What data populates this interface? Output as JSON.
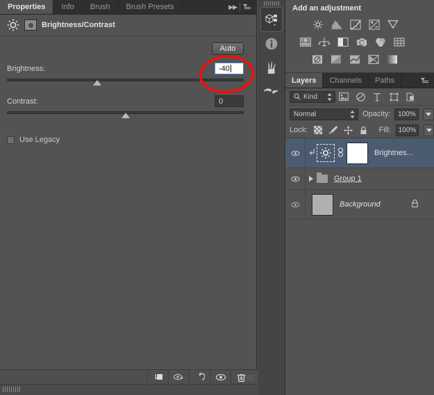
{
  "properties_panel": {
    "tabs": [
      {
        "label": "Properties",
        "active": true
      },
      {
        "label": "Info",
        "active": false
      },
      {
        "label": "Brush",
        "active": false
      },
      {
        "label": "Brush Presets",
        "active": false
      }
    ],
    "collapse_icon": "double-chevron-right-icon",
    "menu_icon": "panel-menu-icon",
    "header": {
      "adjustment_icon": "brightness-contrast-icon",
      "mask_icon": "layer-mask-thumbnail",
      "title": "Brightness/Contrast"
    },
    "auto_button": "Auto",
    "brightness": {
      "label": "Brightness:",
      "value": "-40",
      "slider_percent": 38,
      "focused": true
    },
    "contrast": {
      "label": "Contrast:",
      "value": "0",
      "slider_percent": 50,
      "focused": false
    },
    "use_legacy": {
      "label": "Use Legacy",
      "checked": false
    },
    "footer_icons": [
      "clip-to-layer-icon",
      "view-previous-state-icon",
      "reset-adjustment-icon",
      "toggle-visibility-icon",
      "delete-adjustment-icon"
    ]
  },
  "dock": {
    "items": [
      {
        "name": "mini-bridge-icon",
        "active": true
      },
      {
        "name": "info-icon",
        "active": false
      },
      {
        "name": "brush-icon",
        "active": false
      },
      {
        "name": "brush-presets-icon",
        "active": false
      }
    ]
  },
  "adjustments_panel": {
    "title": "Add an adjustment",
    "row1": [
      "brightness-contrast-icon",
      "levels-icon",
      "curves-icon",
      "exposure-icon",
      "vibrance-icon"
    ],
    "row2": [
      "color-balance-icon",
      "black-and-white-icon",
      "photo-filter-icon",
      "channel-mixer-icon",
      "color-lookup-icon",
      "posterize-icon"
    ],
    "row3": [
      "invert-icon",
      "threshold-icon",
      "selective-color-icon",
      "gradient-map-icon",
      "gradient-fill-icon"
    ]
  },
  "layers_panel": {
    "tabs": [
      {
        "label": "Layers",
        "active": true
      },
      {
        "label": "Channels",
        "active": false
      },
      {
        "label": "Paths",
        "active": false
      }
    ],
    "menu_icon": "panel-menu-icon",
    "filter": {
      "search_icon": "search-icon",
      "kind_label": "Kind",
      "type_icons": [
        "pixel-layer-filter-icon",
        "adjustment-layer-filter-icon",
        "type-layer-filter-icon",
        "shape-layer-filter-icon",
        "smart-object-filter-icon"
      ]
    },
    "blend_mode": "Normal",
    "opacity_label": "Opacity:",
    "opacity_value": "100%",
    "lock_label": "Lock:",
    "lock_icons": [
      "lock-transparency-icon",
      "lock-pixels-icon",
      "lock-position-icon",
      "lock-all-icon"
    ],
    "fill_label": "Fill:",
    "fill_value": "100%",
    "layers": [
      {
        "name": "Brightnes...",
        "selected": true,
        "visible": true,
        "clipped": true,
        "linked": true,
        "style": "normal",
        "thumb": "white-mask-thumbnail",
        "icon": "brightness-contrast-icon",
        "locked": false
      },
      {
        "name": "Group 1",
        "selected": false,
        "visible": true,
        "clipped": false,
        "linked": false,
        "style": "underline",
        "thumb": "folder-icon",
        "icon": "folder-icon",
        "locked": false
      },
      {
        "name": "Background",
        "selected": false,
        "visible": true,
        "clipped": false,
        "linked": false,
        "style": "italic",
        "thumb": "gray-thumbnail",
        "icon": "",
        "locked": true
      }
    ]
  },
  "annotation": {
    "shape": "red-ellipse-highlight",
    "target": "brightness-value-input",
    "color": "#e8140f"
  }
}
